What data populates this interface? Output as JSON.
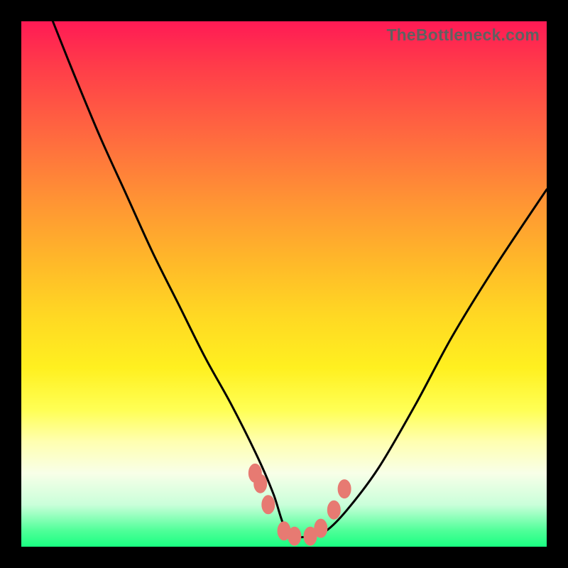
{
  "attribution": "TheBottleneck.com",
  "chart_data": {
    "type": "line",
    "title": "",
    "xlabel": "",
    "ylabel": "",
    "xlim": [
      0,
      100
    ],
    "ylim": [
      0,
      100
    ],
    "series": [
      {
        "name": "bottleneck-curve",
        "x": [
          6,
          10,
          15,
          20,
          25,
          30,
          35,
          40,
          45,
          48,
          50,
          52,
          55,
          58,
          62,
          68,
          75,
          82,
          90,
          100
        ],
        "y": [
          100,
          90,
          78,
          67,
          56,
          46,
          36,
          27,
          17,
          10,
          4,
          2,
          2,
          3,
          7,
          15,
          27,
          40,
          53,
          68
        ]
      }
    ],
    "markers": {
      "name": "highlight-points",
      "x": [
        44.5,
        45.5,
        47,
        50,
        52,
        55,
        57,
        59.5,
        61.5
      ],
      "y": [
        14,
        12,
        8,
        3,
        2,
        2,
        3.5,
        7,
        11
      ]
    },
    "background_gradient": {
      "top": "#ff1a55",
      "mid": "#ffd823",
      "bottom": "#1aff82"
    }
  }
}
